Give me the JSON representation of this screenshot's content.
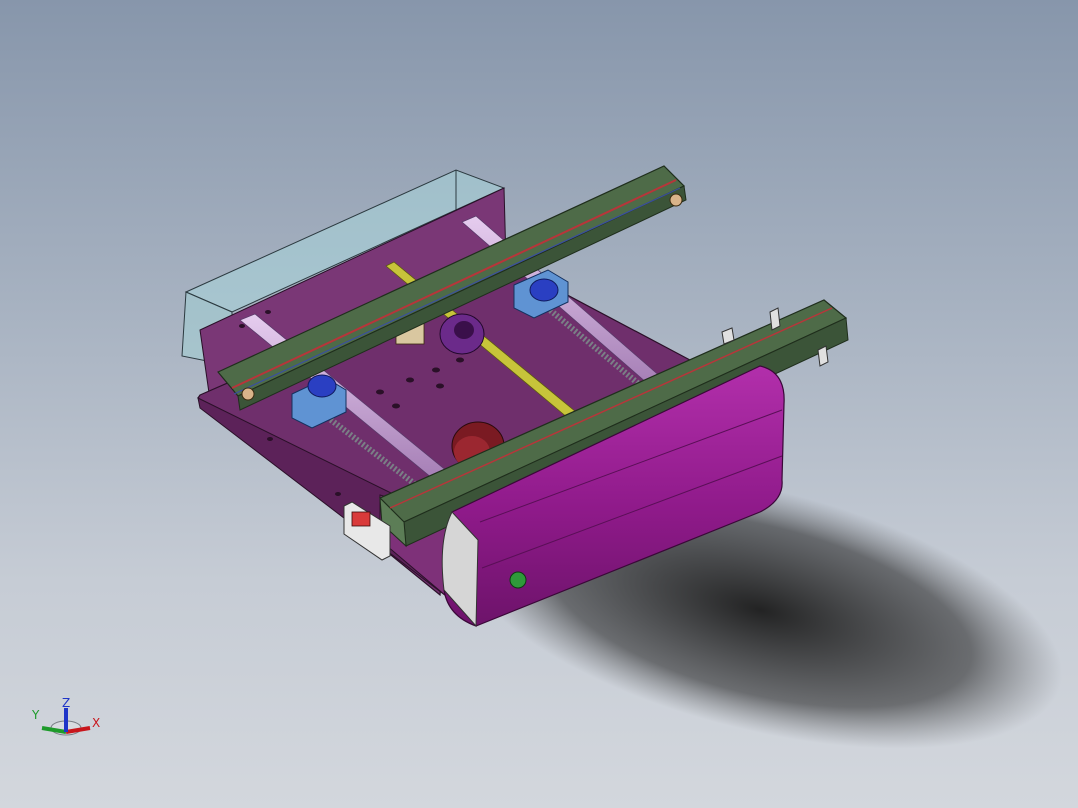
{
  "viewport": {
    "background_top": "#8796ab",
    "background_bottom": "#d3d7dd"
  },
  "triad": {
    "x_label": "X",
    "y_label": "Y",
    "z_label": "Z",
    "x_color": "#c8161c",
    "y_color": "#1d9a2a",
    "z_color": "#1f35c8"
  },
  "model": {
    "plate_color": "#6f2f6c",
    "rail_color": "#4e6b48",
    "cover_color": "#8f1a8a",
    "enclosure_color": "#9fd4d8",
    "bearing_color": "#3b63d6",
    "shaft_color": "#c9a6d6",
    "screw_color": "#c7c43a",
    "motor_color": "#7a1a22"
  }
}
